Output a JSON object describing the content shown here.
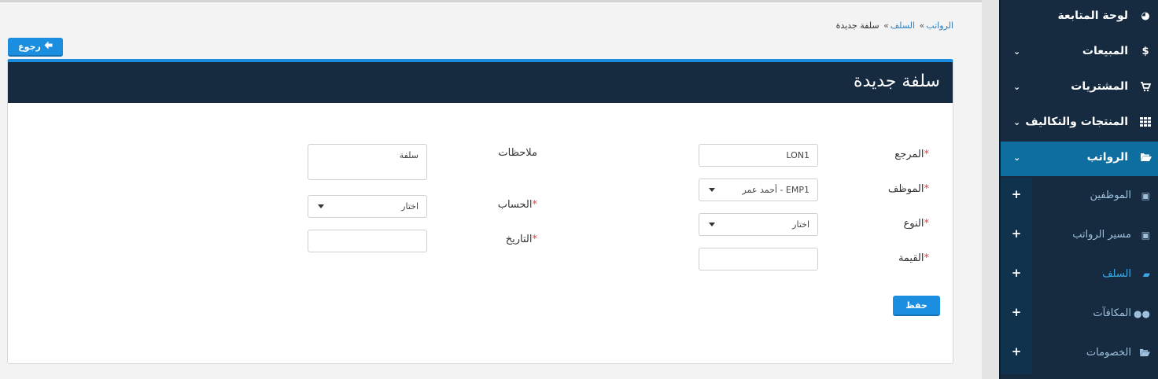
{
  "sidebar": {
    "items": [
      {
        "label": "لوحة المتابعة",
        "icon": "dashboard-icon"
      },
      {
        "label": "المبيعات",
        "icon": "dollar-icon"
      },
      {
        "label": "المشتريات",
        "icon": "cart-icon"
      },
      {
        "label": "المنتجات والتكاليف",
        "icon": "grid-icon"
      },
      {
        "label": "الرواتب",
        "icon": "folder-open-icon"
      }
    ],
    "subitems": [
      {
        "label": "الموظفين",
        "icon": "calendar-check-icon"
      },
      {
        "label": "مسير الرواتب",
        "icon": "calendar-check-icon"
      },
      {
        "label": "السلف",
        "icon": "book-icon"
      },
      {
        "label": "المكافآت",
        "icon": "users-icon"
      },
      {
        "label": "الخصومات",
        "icon": "folder-open-icon"
      }
    ],
    "plus": "+"
  },
  "breadcrumb": {
    "item1": "الرواتب",
    "item2": "السلف",
    "current": "سلفة جديدة",
    "sep": "»"
  },
  "back_button": {
    "label": "رجوع"
  },
  "panel": {
    "title": "سلفة جديدة"
  },
  "form": {
    "reference": {
      "label": "المرجع",
      "value": "LON1"
    },
    "employee": {
      "label": "الموظف",
      "value": "EMP1 - أحمد عمر"
    },
    "type": {
      "label": "النوع",
      "value": "اختار"
    },
    "amount": {
      "label": "القيمة",
      "value": ""
    },
    "notes": {
      "label": "ملاحظات",
      "value": "سلفة"
    },
    "account": {
      "label": "الحساب",
      "value": "اختار"
    },
    "date": {
      "label": "التاريخ",
      "value": ""
    },
    "required_mark": "*"
  },
  "save_button": {
    "label": "حفظ"
  }
}
